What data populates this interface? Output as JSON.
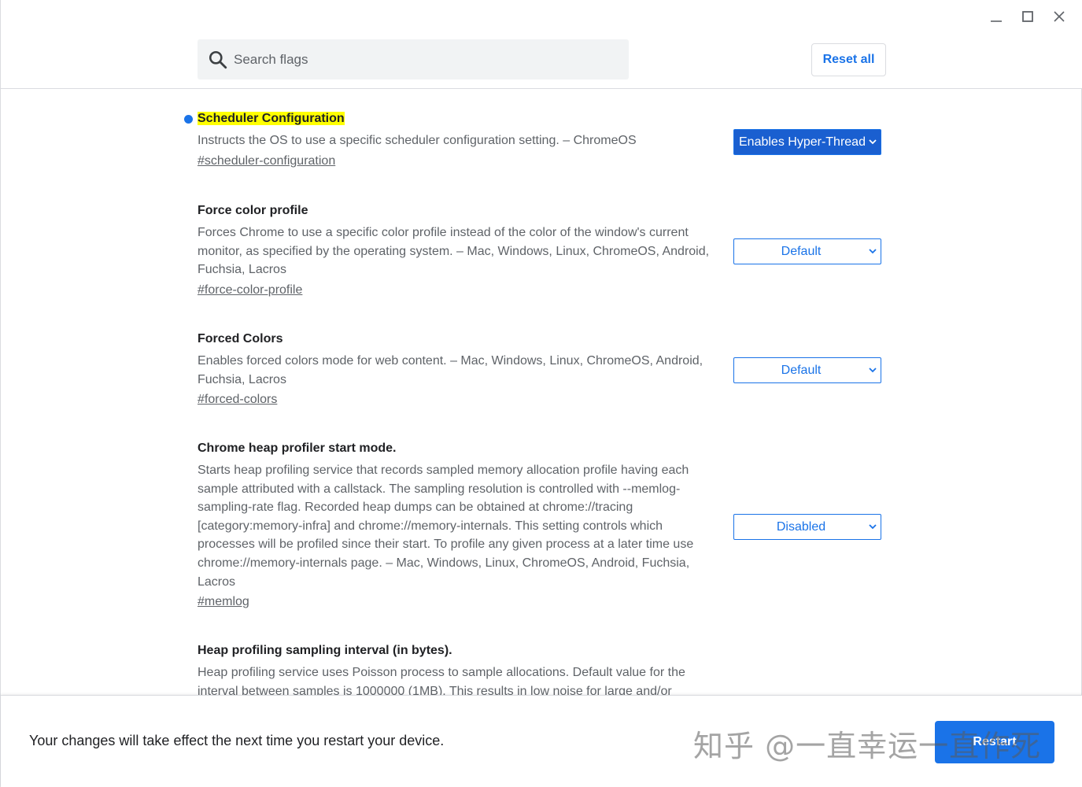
{
  "window": {
    "minimize_label": "Minimize",
    "maximize_label": "Maximize",
    "close_label": "Close"
  },
  "header": {
    "search": {
      "placeholder": "Search flags",
      "value": ""
    },
    "reset_all_label": "Reset all"
  },
  "flags": [
    {
      "title": "Scheduler Configuration",
      "description": "Instructs the OS to use a specific scheduler configuration setting. – ChromeOS",
      "link": "#scheduler-configuration",
      "selected_option": "Enables Hyper-Thread",
      "modified": true
    },
    {
      "title": "Force color profile",
      "description": "Forces Chrome to use a specific color profile instead of the color of the window's current monitor, as specified by the operating system. – Mac, Windows, Linux, ChromeOS, Android, Fuchsia, Lacros",
      "link": "#force-color-profile",
      "selected_option": "Default"
    },
    {
      "title": "Forced Colors",
      "description": "Enables forced colors mode for web content. – Mac, Windows, Linux, ChromeOS, Android, Fuchsia, Lacros",
      "link": "#forced-colors",
      "selected_option": "Default"
    },
    {
      "title": "Chrome heap profiler start mode.",
      "description": "Starts heap profiling service that records sampled memory allocation profile having each sample attributed with a callstack. The sampling resolution is controlled with --memlog-sampling-rate flag. Recorded heap dumps can be obtained at chrome://tracing [category:memory-infra] and chrome://memory-internals. This setting controls which processes will be profiled since their start. To profile any given process at a later time use chrome://memory-internals page. – Mac, Windows, Linux, ChromeOS, Android, Fuchsia, Lacros",
      "link": "#memlog",
      "selected_option": "Disabled"
    },
    {
      "title": "Heap profiling sampling interval (in bytes).",
      "description": "Heap profiling service uses Poisson process to sample allocations. Default value for the interval between samples is 1000000 (1MB). This results in low noise for large and/or"
    }
  ],
  "footer": {
    "message": "Your changes will take effect the next time you restart your device.",
    "restart_label": "Restart"
  },
  "watermark": "知乎 @一直幸运一直作死",
  "colors": {
    "accent": "#1a73e8",
    "highlight": "#ffff00",
    "text_secondary": "#5f6368"
  },
  "icons": [
    "search-icon",
    "minimize-icon",
    "maximize-icon",
    "close-icon",
    "chevron-down-icon"
  ]
}
